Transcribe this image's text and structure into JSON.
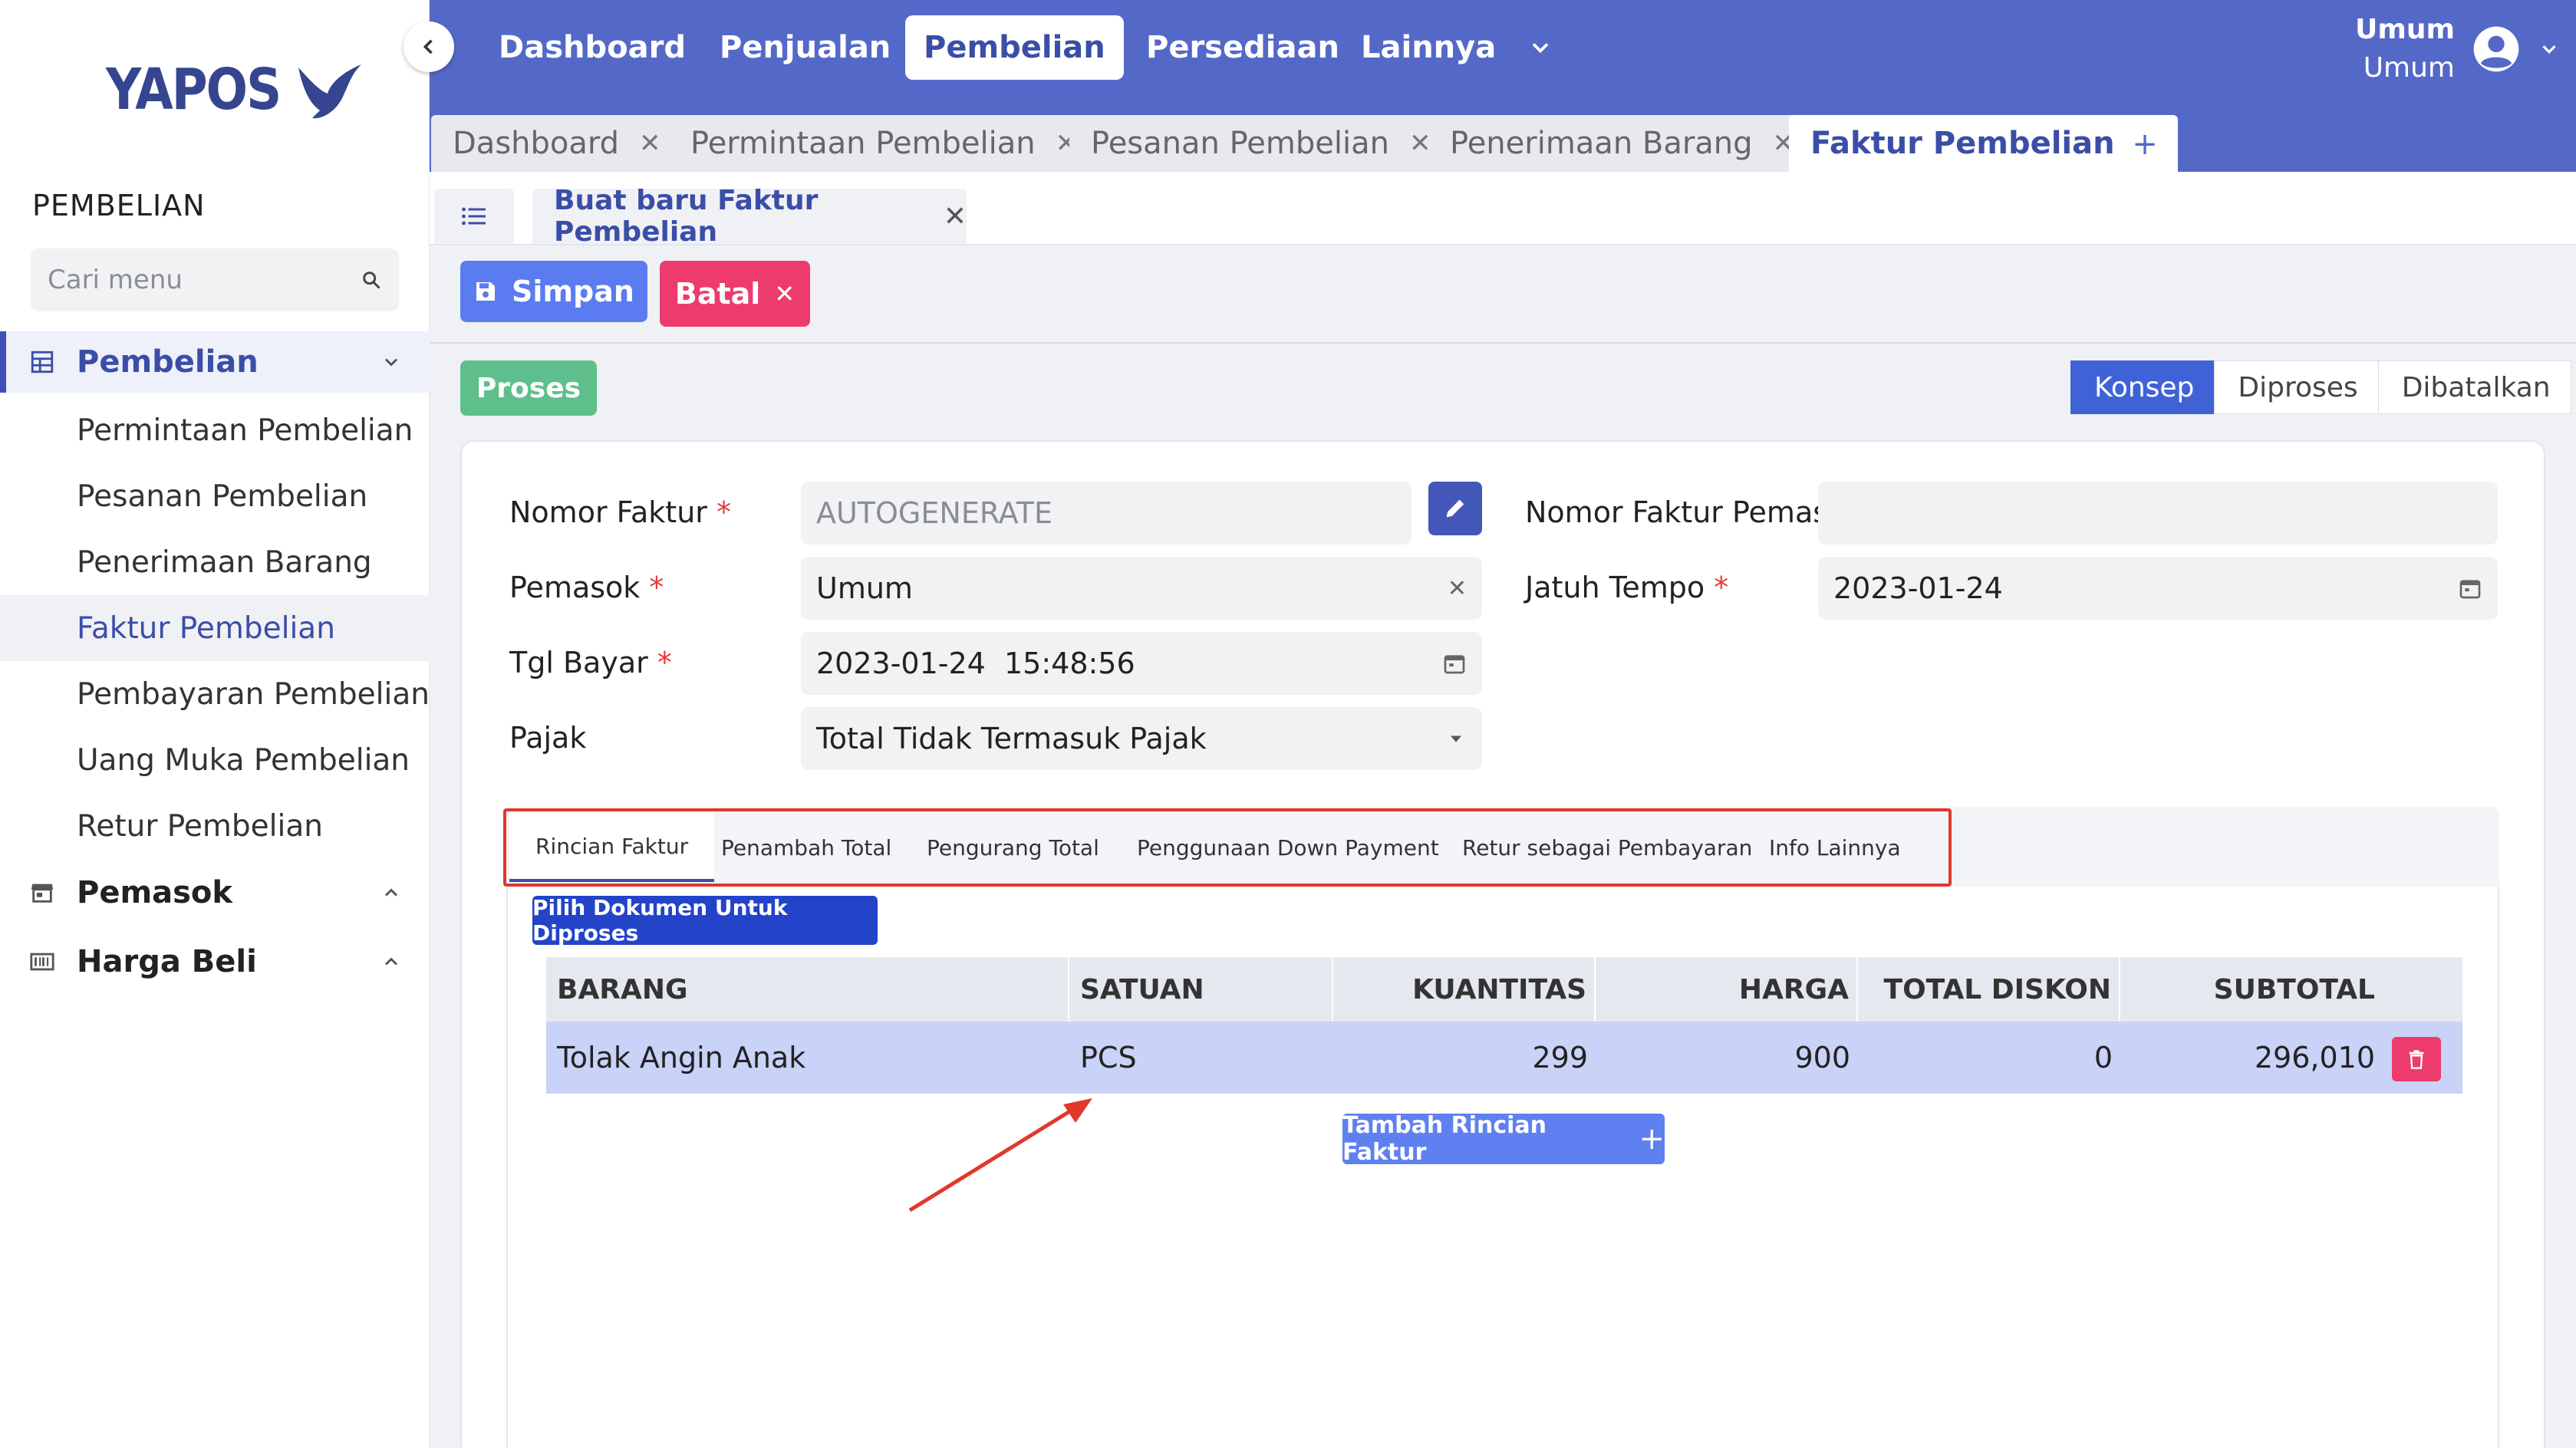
{
  "sidebar": {
    "logo_text": "YAPOS",
    "section_title": "PEMBELIAN",
    "search_placeholder": "Cari menu",
    "groups": [
      {
        "label": "Pembelian",
        "icon": "table-icon",
        "expanded": true
      },
      {
        "label": "Pemasok",
        "icon": "store-icon",
        "expanded": false
      },
      {
        "label": "Harga Beli",
        "icon": "barcode-icon",
        "expanded": false
      }
    ],
    "items": [
      {
        "label": "Permintaan Pembelian"
      },
      {
        "label": "Pesanan Pembelian"
      },
      {
        "label": "Penerimaan Barang"
      },
      {
        "label": "Faktur Pembelian",
        "active": true
      },
      {
        "label": "Pembayaran Pembelian"
      },
      {
        "label": "Uang Muka Pembelian"
      },
      {
        "label": "Retur Pembelian"
      }
    ]
  },
  "topnav": {
    "items": [
      "Dashboard",
      "Penjualan",
      "Pembelian",
      "Persediaan",
      "Lainnya"
    ],
    "active": "Pembelian",
    "user_line1": "Umum",
    "user_line2": "Umum"
  },
  "page_tabs": [
    {
      "label": "Dashboard"
    },
    {
      "label": "Permintaan Pembelian"
    },
    {
      "label": "Pesanan Pembelian"
    },
    {
      "label": "Penerimaan Barang"
    },
    {
      "label": "Faktur Pembelian",
      "active": true
    }
  ],
  "doc_tab": {
    "label": "Buat baru Faktur Pembelian"
  },
  "actions": {
    "save": "Simpan",
    "cancel": "Batal",
    "process": "Proses"
  },
  "status_steps": [
    "Konsep",
    "Diproses",
    "Dibatalkan"
  ],
  "status_active": "Konsep",
  "form": {
    "nomor_faktur": {
      "label": "Nomor Faktur",
      "placeholder": "AUTOGENERATE"
    },
    "pemasok": {
      "label": "Pemasok",
      "value": "Umum"
    },
    "tgl_bayar": {
      "label": "Tgl Bayar",
      "value": "2023-01-24  15:48:56"
    },
    "pajak": {
      "label": "Pajak",
      "value": "Total Tidak Termasuk Pajak"
    },
    "nomor_faktur_pemasok": {
      "label": "Nomor Faktur Pemasok",
      "value": ""
    },
    "jatuh_tempo": {
      "label": "Jatuh Tempo",
      "value": "2023-01-24"
    }
  },
  "inner_tabs": [
    "Rincian Faktur",
    "Penambah Total",
    "Pengurang Total",
    "Penggunaan Down Payment",
    "Retur sebagai Pembayaran",
    "Info Lainnya"
  ],
  "pick_button": "Pilih Dokumen Untuk Diproses",
  "table": {
    "headers": [
      "BARANG",
      "SATUAN",
      "KUANTITAS",
      "HARGA",
      "TOTAL DISKON",
      "SUBTOTAL"
    ],
    "rows": [
      [
        "Tolak Angin Anak",
        "PCS",
        "299",
        "900",
        "0",
        "296,010"
      ]
    ]
  },
  "add_row_button": "Tambah Rincian Faktur",
  "colors": {
    "primary": "#5469c7",
    "danger": "#ee3b6d",
    "success": "#5fbf8c",
    "annotation": "#e0382b"
  }
}
